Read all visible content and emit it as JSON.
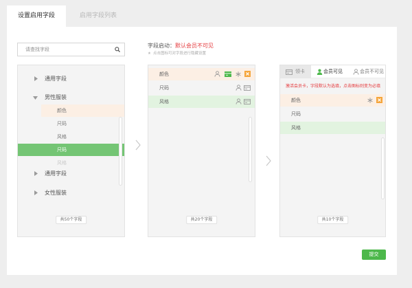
{
  "tabs": [
    {
      "label": "设置启用字段",
      "active": true
    },
    {
      "label": "启用字段列表",
      "active": false
    }
  ],
  "search": {
    "placeholder": "请查找字段",
    "icon": "search-icon"
  },
  "field_tree": {
    "groups": [
      {
        "label": "通用字段",
        "expanded": false,
        "icon": "caret-right-icon"
      },
      {
        "label": "男性服装",
        "expanded": true,
        "icon": "caret-down-icon",
        "children": [
          {
            "label": "颜色",
            "highlighted": true
          },
          {
            "label": "尺码"
          },
          {
            "label": "风格"
          },
          {
            "label": "尺码",
            "selected": true
          },
          {
            "label": "风格",
            "disabled": true
          }
        ]
      },
      {
        "label": "通用字段",
        "expanded": false,
        "icon": "caret-right-icon"
      },
      {
        "label": "女性服装",
        "expanded": false,
        "icon": "caret-right-icon"
      }
    ],
    "count": "共50个字段"
  },
  "enabled_fields": {
    "heading_label": "字段启动：",
    "heading_value": "默认会员不可见",
    "hint_icon": "star-icon",
    "hint": "点击图标可对字段进行隐藏设置",
    "rows": [
      {
        "label": "颜色",
        "highlighted": true,
        "icons": [
          "person-icon",
          "card-icon",
          "required-icon",
          "delete-icon"
        ]
      },
      {
        "label": "尺码",
        "icons": [
          "person-icon",
          "card-icon"
        ]
      },
      {
        "label": "风格",
        "selected": true,
        "icons": [
          "person-icon",
          "card-icon"
        ]
      }
    ],
    "count": "共20个字段"
  },
  "card_fields": {
    "tabs": [
      {
        "label": "领卡",
        "icon": "card-icon"
      },
      {
        "label": "会员可见",
        "icon": "person-icon",
        "active": true
      },
      {
        "label": "会员不可见",
        "icon": "person-icon"
      }
    ],
    "notice": "激活会员卡，字段默认为选填，点击图标则变为必填",
    "rows": [
      {
        "label": "颜色",
        "highlighted": true,
        "icons": [
          "required-icon",
          "delete-icon"
        ]
      },
      {
        "label": "尺码"
      },
      {
        "label": "风格",
        "selected": true
      }
    ],
    "count": "共10个字段"
  },
  "submit": {
    "label": "提交"
  },
  "colors": {
    "accent_green": "#4db84b",
    "warning_red": "#e4393c",
    "delete_orange": "#f5a53b",
    "hover_bg": "#fcefe4",
    "selected_green": "#74c574",
    "selected_light": "#e2f3e0"
  }
}
